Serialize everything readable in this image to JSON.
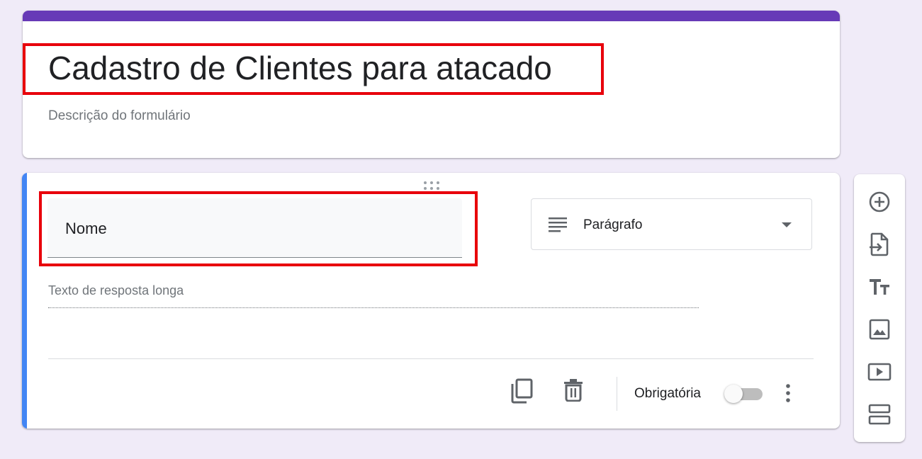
{
  "form": {
    "title": "Cadastro de Clientes para atacado",
    "description_placeholder": "Descrição do formulário",
    "accent_color": "#673ab7"
  },
  "question": {
    "title": "Nome",
    "type_label": "Parágrafo",
    "type_icon": "paragraph-icon",
    "answer_hint": "Texto de resposta longa",
    "required_label": "Obrigatória",
    "required": false,
    "active_accent_color": "#4285f4",
    "footer_icons": [
      "copy-icon",
      "trash-icon",
      "more-vert-icon"
    ]
  },
  "side_toolbar": {
    "items": [
      "add-circle-icon",
      "import-questions-icon",
      "title-text-icon",
      "image-icon",
      "video-icon",
      "section-icon"
    ]
  },
  "highlight_color": "#e8000b"
}
